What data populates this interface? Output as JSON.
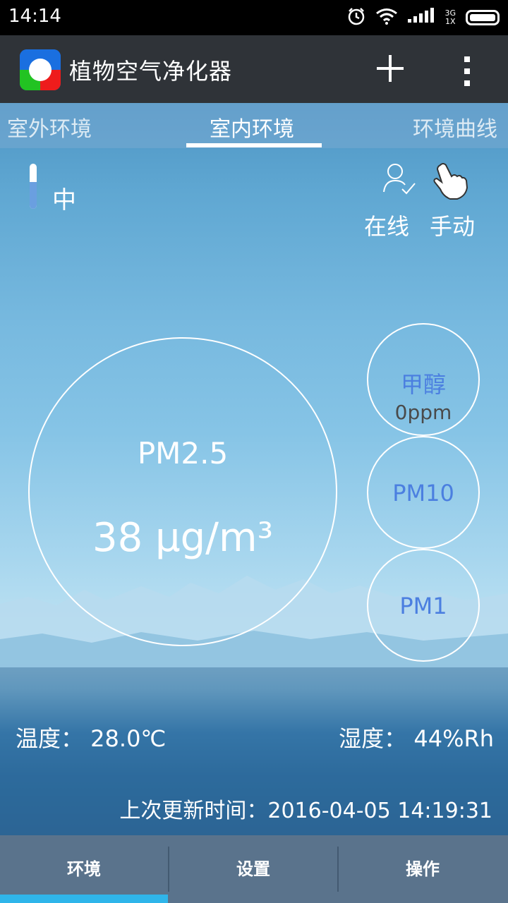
{
  "statusbar": {
    "time": "14:14",
    "network": "3G",
    "network_sub": "1X"
  },
  "app": {
    "title": "植物空气净化器"
  },
  "tabs": [
    {
      "label": "室外环境",
      "active": false
    },
    {
      "label": "室内环境",
      "active": true
    },
    {
      "label": "环境曲线",
      "active": false
    }
  ],
  "level": {
    "label": "中",
    "fill_fraction": 0.6,
    "fill_color": "#6a9fe0"
  },
  "status": {
    "online_label": "在线",
    "mode_label": "手动"
  },
  "pm25": {
    "label": "PM2.5",
    "value": "38 μg/m³"
  },
  "side": [
    {
      "label": "甲醇",
      "value": "0ppm"
    },
    {
      "label": "PM10"
    },
    {
      "label": "PM1"
    }
  ],
  "readouts": {
    "temperature": "温度： 28.0℃",
    "humidity": "湿度： 44%Rh"
  },
  "updated": "上次更新时间：2016-04-05 14:19:31",
  "bottom_nav": [
    {
      "label": "环境",
      "active": true
    },
    {
      "label": "设置",
      "active": false
    },
    {
      "label": "操作",
      "active": false
    }
  ],
  "colors": {
    "accent": "#2fb5ea",
    "side_label": "#4b7fe0",
    "actionbar": "#2f3338",
    "bottom_nav": "#5a738c"
  }
}
